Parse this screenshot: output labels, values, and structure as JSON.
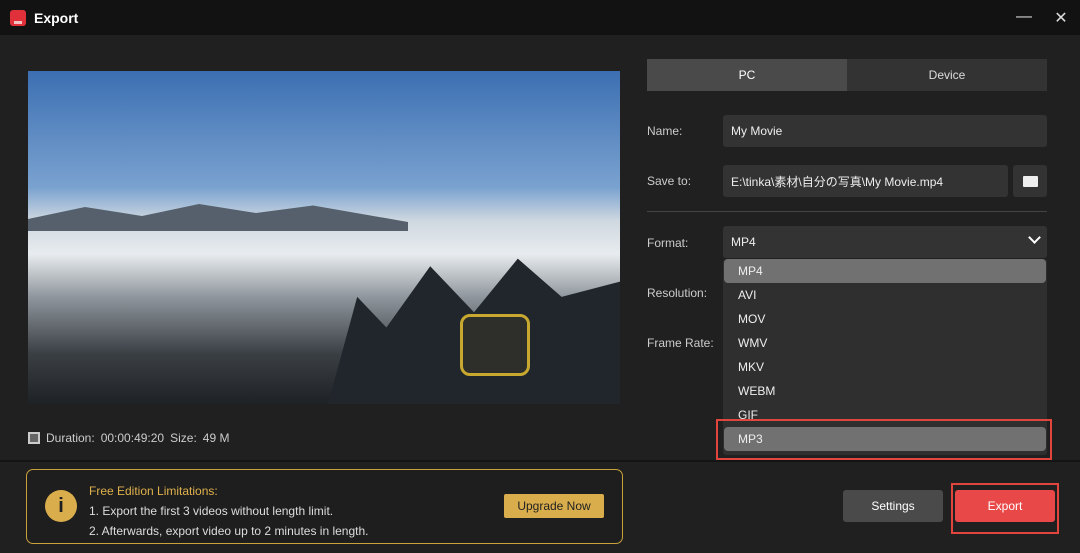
{
  "window": {
    "title": "Export",
    "minimize": "—",
    "close": "✕"
  },
  "media": {
    "duration_label": "Duration:",
    "duration": "00:00:49:20",
    "size_label": "Size:",
    "size": "49 M"
  },
  "tabs": [
    {
      "label": "PC",
      "active": true
    },
    {
      "label": "Device",
      "active": false
    }
  ],
  "form": {
    "name_label": "Name:",
    "name_value": "My Movie",
    "save_label": "Save to:",
    "save_value": "E:\\tinka\\素材\\自分の写真\\My Movie.mp4",
    "format_label": "Format:",
    "format_value": "MP4",
    "resolution_label": "Resolution:",
    "frame_rate_label": "Frame Rate:"
  },
  "format_options": [
    "MP4",
    "AVI",
    "MOV",
    "WMV",
    "MKV",
    "WEBM",
    "GIF",
    "MP3"
  ],
  "notice": {
    "title": "Free Edition Limitations:",
    "line1": "1. Export the first 3 videos without length limit.",
    "line2": "2. Afterwards, export video up to 2 minutes in length.",
    "upgrade": "Upgrade Now"
  },
  "buttons": {
    "settings": "Settings",
    "export": "Export"
  },
  "colors": {
    "accent": "#e94848",
    "gold": "#d9ad4c",
    "highlight": "#e0453e"
  }
}
